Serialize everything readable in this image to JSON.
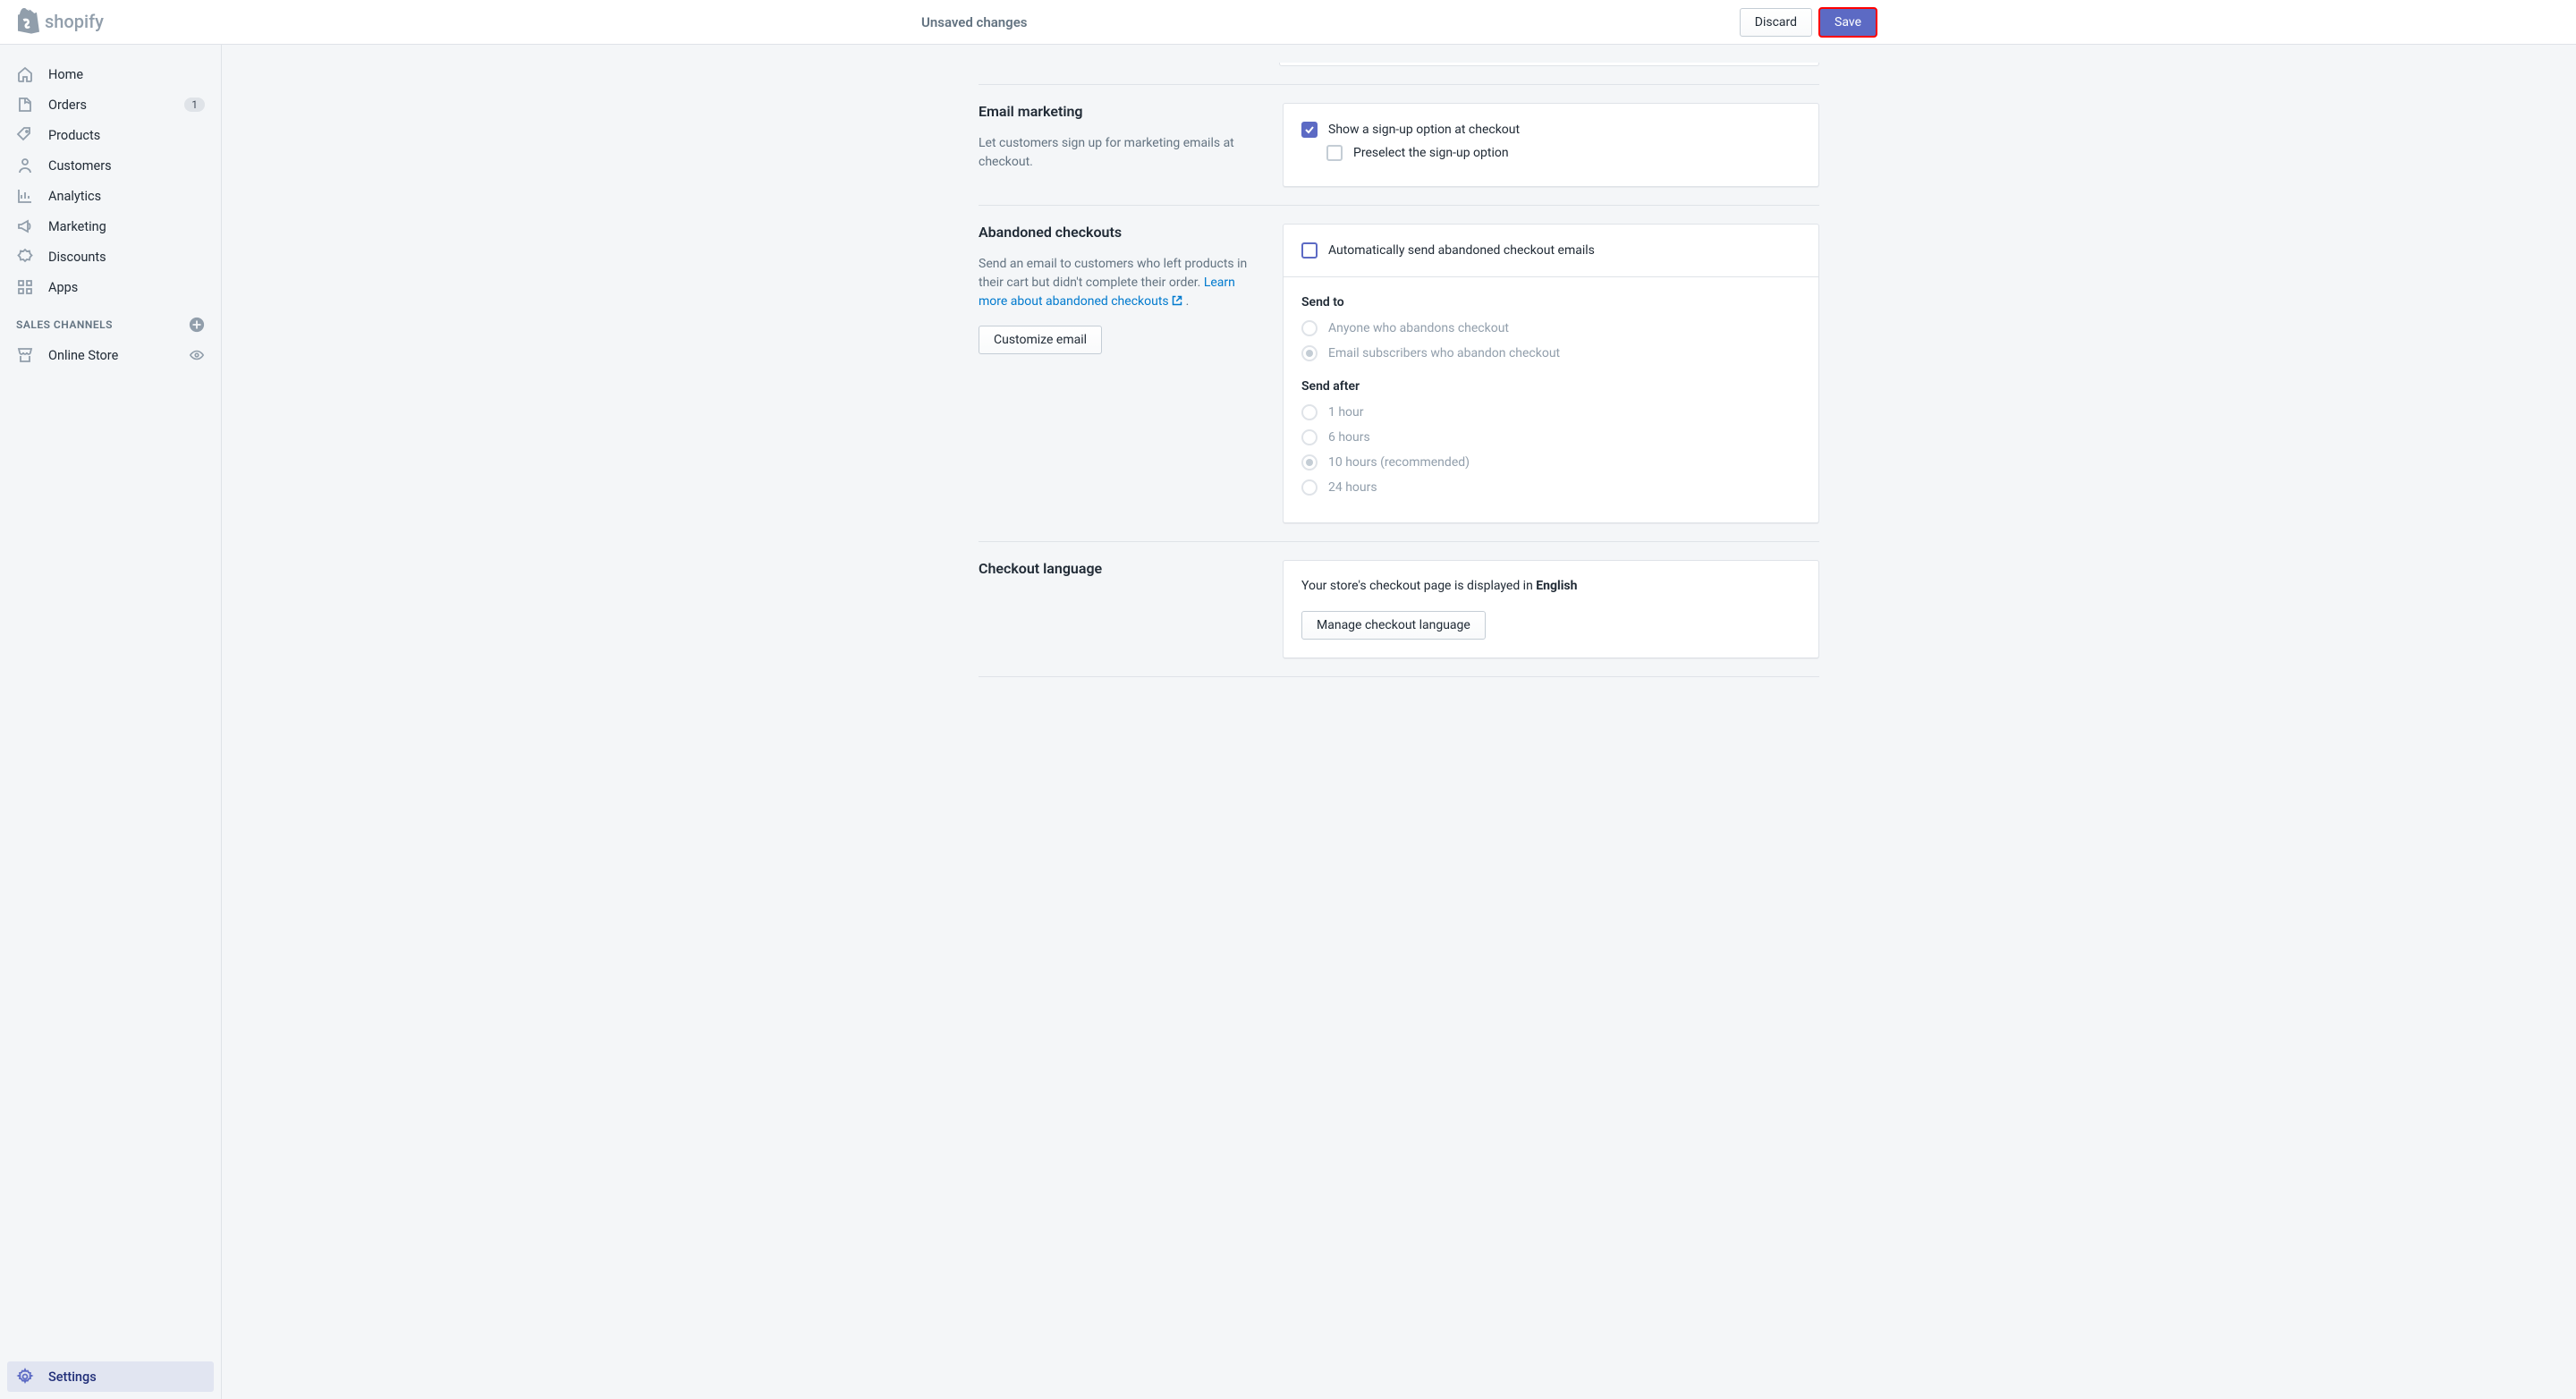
{
  "topbar": {
    "title": "Unsaved changes",
    "discard": "Discard",
    "save": "Save"
  },
  "sidebar": {
    "items": [
      {
        "label": "Home"
      },
      {
        "label": "Orders",
        "badge": "1"
      },
      {
        "label": "Products"
      },
      {
        "label": "Customers"
      },
      {
        "label": "Analytics"
      },
      {
        "label": "Marketing"
      },
      {
        "label": "Discounts"
      },
      {
        "label": "Apps"
      }
    ],
    "channels_header": "SALES CHANNELS",
    "channels": [
      {
        "label": "Online Store"
      }
    ],
    "settings": "Settings"
  },
  "email_marketing": {
    "title": "Email marketing",
    "desc": "Let customers sign up for marketing emails at checkout.",
    "opt_show": "Show a sign-up option at checkout",
    "opt_preselect": "Preselect the sign-up option"
  },
  "abandoned": {
    "title": "Abandoned checkouts",
    "desc_pre": "Send an email to customers who left products in their cart but didn't complete their order. ",
    "link": "Learn more about abandoned checkouts",
    "desc_post": " .",
    "customize_btn": "Customize email",
    "auto_send": "Automatically send abandoned checkout emails",
    "send_to_label": "Send to",
    "send_to_options": [
      "Anyone who abandons checkout",
      "Email subscribers who abandon checkout"
    ],
    "send_after_label": "Send after",
    "send_after_options": [
      "1 hour",
      "6 hours",
      "10 hours (recommended)",
      "24 hours"
    ]
  },
  "checkout_language": {
    "title": "Checkout language",
    "desc_pre": "Your store's checkout page is displayed in ",
    "language": "English",
    "manage_btn": "Manage checkout language"
  }
}
